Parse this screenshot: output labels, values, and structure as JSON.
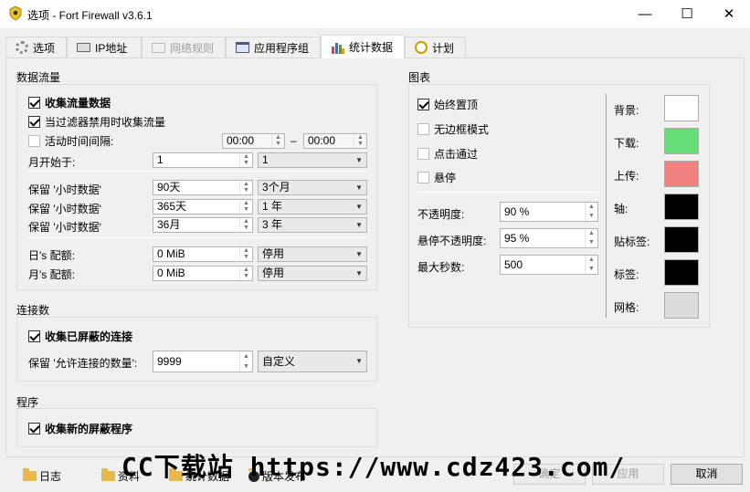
{
  "window": {
    "title": "选项 - Fort Firewall v3.6.1",
    "minimize": "—",
    "maximize": "☐",
    "close": "✕"
  },
  "tabs": [
    {
      "label": "选项",
      "icon": "gear-icon"
    },
    {
      "label": "IP地址",
      "icon": "ip-icon"
    },
    {
      "label": "网络规则",
      "icon": "network-icon"
    },
    {
      "label": "应用程序组",
      "icon": "window-icon"
    },
    {
      "label": "统计数据",
      "icon": "bar-chart-icon"
    },
    {
      "label": "计划",
      "icon": "clock-icon"
    }
  ],
  "traffic": {
    "title": "数据流量",
    "collect_traffic": "收集流量数据",
    "collect_when_filter_off": "当过滤器禁用时收集流量",
    "active_period": "活动时间间隔:",
    "period_from": "00:00",
    "period_dash": "–",
    "period_to": "00:00",
    "month_start_label": "月开始于:",
    "month_start_value": "1",
    "month_start_combo": "1",
    "keep_hours_1_label": "保留 '小时数据'",
    "keep_hours_1_value": "90天",
    "keep_hours_1_combo": "3个月",
    "keep_hours_2_label": "保留 '小时数据'",
    "keep_hours_2_value": "365天",
    "keep_hours_2_combo": "1 年",
    "keep_hours_3_label": "保留 '小时数据'",
    "keep_hours_3_value": "36月",
    "keep_hours_3_combo": "3 年",
    "day_quota_label": "日's 配额:",
    "day_quota_value": "0 MiB",
    "day_quota_combo": "停用",
    "month_quota_label": "月's 配额:",
    "month_quota_value": "0 MiB",
    "month_quota_combo": "停用"
  },
  "connections": {
    "title": "连接数",
    "collect_blocked": "收集已屏蔽的连接",
    "keep_allowed_label": "保留 '允许连接的数量':",
    "keep_allowed_value": "9999",
    "keep_allowed_combo": "自定义"
  },
  "programs": {
    "title": "程序",
    "collect_new_blocked": "收集新的屏蔽程序"
  },
  "graph": {
    "title": "图表",
    "always_on_top": "始终置顶",
    "frameless": "无边框模式",
    "click_through": "点击通过",
    "hide_on_hover": "悬停",
    "opacity_label": "不透明度:",
    "opacity_value": "90 %",
    "hover_opacity_label": "悬停不透明度:",
    "hover_opacity_value": "95 %",
    "max_seconds_label": "最大秒数:",
    "max_seconds_value": "500",
    "colors": [
      {
        "label": "背景:",
        "color": "#ffffff"
      },
      {
        "label": "下载:",
        "color": "#66dd77"
      },
      {
        "label": "上传:",
        "color": "#f08080"
      },
      {
        "label": "轴:",
        "color": "#000000"
      },
      {
        "label": "贴标签:",
        "color": "#000000"
      },
      {
        "label": "标签:",
        "color": "#000000"
      },
      {
        "label": "网格:",
        "color": "#dcdcdc"
      }
    ]
  },
  "footer": {
    "links": [
      "日志",
      "资料",
      "统计数据",
      "版本发布"
    ],
    "ok": "确定",
    "apply": "应用",
    "cancel": "取消"
  },
  "watermark": "CC下载站 https://www.cdz423.com/"
}
